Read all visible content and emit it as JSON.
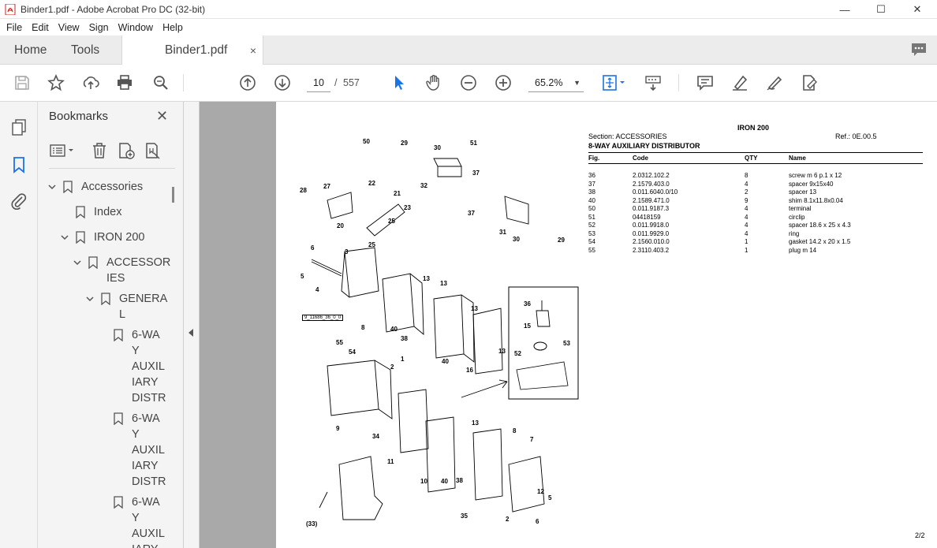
{
  "window": {
    "title": "Binder1.pdf - Adobe Acrobat Pro DC (32-bit)",
    "minimize": "—",
    "maximize": "☐",
    "close": "✕"
  },
  "menu": [
    "File",
    "Edit",
    "View",
    "Sign",
    "Window",
    "Help"
  ],
  "tabs": {
    "home": "Home",
    "tools": "Tools",
    "document": "Binder1.pdf",
    "close": "×"
  },
  "toolbar": {
    "current_page": "10",
    "page_separator": "/",
    "total_pages": "557",
    "zoom": "65.2%",
    "icons": [
      "save-icon",
      "star-icon",
      "upload-icon",
      "print-icon",
      "search-zoom-icon",
      "page-up-icon",
      "page-down-icon",
      "select-cursor-icon",
      "hand-icon",
      "zoom-out-icon",
      "zoom-in-icon",
      "fit-page-icon",
      "scroll-mode-icon",
      "comment-icon",
      "highlight-icon",
      "sign-icon",
      "edit-pdf-icon"
    ]
  },
  "bookmarks": {
    "heading": "Bookmarks",
    "close": "✕",
    "items": [
      {
        "label": "Accessories"
      },
      {
        "label": "Index"
      },
      {
        "label": "IRON 200"
      },
      {
        "label_lines": [
          "ACCESSOR",
          "IES"
        ]
      },
      {
        "label_lines": [
          "GENERA",
          "L"
        ]
      },
      {
        "label_lines": [
          "6-WA",
          "Y",
          "AUXIL",
          "IARY",
          "DISTR"
        ]
      },
      {
        "label_lines": [
          "6-WA",
          "Y",
          "AUXIL",
          "IARY",
          "DISTR"
        ]
      },
      {
        "label_lines": [
          "6-WA",
          "Y",
          "AUXIL",
          "IARY"
        ]
      }
    ]
  },
  "document": {
    "model": "IRON 200",
    "section": "Section: ACCESSORIES",
    "ref": "Ref.: 0E.00.5",
    "title": "8-WAY AUXILIARY DISTRIBUTOR",
    "columns": [
      "Fig.",
      "Code",
      "QTY",
      "Name"
    ],
    "rows": [
      [
        "36",
        "2.0312.102.2",
        "8",
        "screw m 6 p.1 x 12"
      ],
      [
        "37",
        "2.1579.403.0",
        "4",
        "spacer 9x15x40"
      ],
      [
        "38",
        "0.011.6040.0/10",
        "2",
        "spacer 13"
      ],
      [
        "40",
        "2.1589.471.0",
        "9",
        "shim 8.1x11.8x0.04"
      ],
      [
        "50",
        "0.011.9187.3",
        "4",
        "terminal"
      ],
      [
        "51",
        "04418159",
        "4",
        "circlip"
      ],
      [
        "52",
        "0.011.9918.0",
        "4",
        "spacer 18.6 x 25 x 4.3"
      ],
      [
        "53",
        "0.011.9929.0",
        "4",
        "ring"
      ],
      [
        "54",
        "2.1560.010.0",
        "1",
        "gasket 14.2 x 20 x 1.5"
      ],
      [
        "55",
        "2.3110.403.2",
        "1",
        "plug m 14"
      ]
    ],
    "page_number": "2/2",
    "diagram_tag": "9_11686_36_0_0",
    "diagram_labels": [
      "50",
      "29",
      "30",
      "51",
      "37",
      "32",
      "28",
      "27",
      "22",
      "21",
      "23",
      "20",
      "25",
      "25",
      "37",
      "31",
      "30",
      "29",
      "6",
      "3",
      "5",
      "4",
      "13",
      "13",
      "8",
      "40",
      "38",
      "13",
      "40",
      "16",
      "13",
      "36",
      "15",
      "53",
      "52",
      "55",
      "54",
      "1",
      "2",
      "9",
      "34",
      "11",
      "8",
      "13",
      "7",
      "10",
      "40",
      "38",
      "12",
      "35",
      "2",
      "5",
      "6",
      "(33)"
    ]
  }
}
